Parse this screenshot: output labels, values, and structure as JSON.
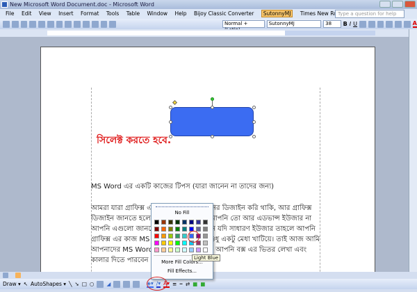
{
  "window": {
    "title": "New Microsoft Word Document.doc - Microsoft Word"
  },
  "menu": {
    "items": [
      "File",
      "Edit",
      "View",
      "Insert",
      "Format",
      "Tools",
      "Table",
      "Window",
      "Help",
      "Bijoy Classic Converter",
      "SutonnyMJ",
      "Times New Roman"
    ],
    "help_placeholder": "Type a question for help"
  },
  "formatting": {
    "style": "Normal + (Latin)",
    "font": "SutonnyMJ",
    "size": "38"
  },
  "document": {
    "red_note": "সিলেক্ট করতে হবে.",
    "heading": "MS Word এর একটি কাজের টিপস (যারা জানেন না তাদের জন্য)",
    "lines": [
      {
        "left": "আমরা যারা গ্রাফিক্স এ",
        "right": "নের ডিজাইন করি থাকি, আর গ্রাফিক্স"
      },
      {
        "left": "ডিজাইন জানতে হলে",
        "right": "আপনি তো আর এডভান্স ইউজার না"
      },
      {
        "left": "আপনি এগুলো জানবে",
        "right": "নি যদি সাধারণ ইউজার তাহলে আপনি"
      },
      {
        "left": "গ্রাফিক্স এর কাজ MS",
        "right": "শুধু একটু মেধা খাটিয়ে। তাই আজ আমি"
      },
      {
        "left": "আপনাদের MS Word",
        "right": "য় আপনি বক্স এর ভিতর লেখা এবং"
      },
      {
        "left": "কালার দিতে পারবেন",
        "right": ""
      }
    ],
    "shape_color": "#3b6cf2"
  },
  "fill_popup": {
    "no_fill": "No Fill",
    "colors": [
      "#000000",
      "#993300",
      "#333300",
      "#003300",
      "#003366",
      "#000080",
      "#333399",
      "#333333",
      "#800000",
      "#ff6600",
      "#808000",
      "#008000",
      "#008080",
      "#0000ff",
      "#666699",
      "#808080",
      "#ff0000",
      "#ff9900",
      "#99cc00",
      "#339966",
      "#33cccc",
      "#3366ff",
      "#800080",
      "#969696",
      "#ff00ff",
      "#ffcc00",
      "#ffff00",
      "#00ff00",
      "#00ffff",
      "#00ccff",
      "#993366",
      "#c0c0c0",
      "#ff99cc",
      "#ffcc99",
      "#ffff99",
      "#ccffcc",
      "#ccffff",
      "#99ccff",
      "#cc99ff",
      "#ffffff"
    ],
    "selected": "Light Blue",
    "more": "More Fill Colors...",
    "effects": "Fill Effects..."
  },
  "drawbar": {
    "draw": "Draw ▾",
    "autoshapes": "AutoShapes ▾"
  }
}
